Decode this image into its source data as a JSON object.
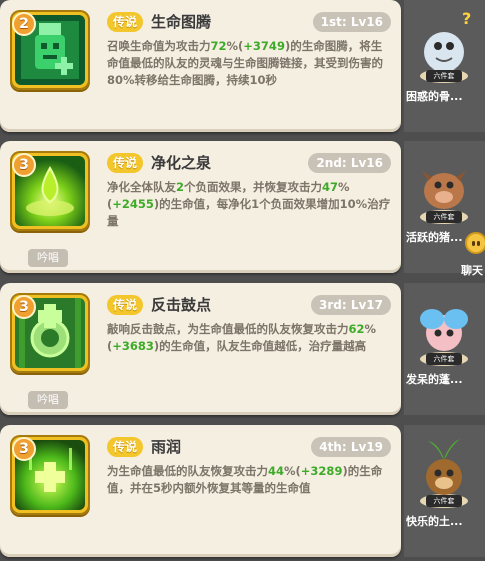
{
  "skills": [
    {
      "level_badge": "2",
      "rarity": "传说",
      "name": "生命图腾",
      "slot_level": "1st: Lv16",
      "desc": [
        {
          "t": "召唤生命值为攻击力"
        },
        {
          "t": "72",
          "g": true
        },
        {
          "t": "%("
        },
        {
          "t": "+3749",
          "g": true
        },
        {
          "t": ")的生命图腾，将生命值最低的队友的灵魂与生命图腾链接，其受到伤害的80%转移给生命图腾，持续10秒"
        }
      ],
      "chant": ""
    },
    {
      "level_badge": "3",
      "rarity": "传说",
      "name": "净化之泉",
      "slot_level": "2nd: Lv16",
      "desc": [
        {
          "t": "净化全体队友"
        },
        {
          "t": "2",
          "g": true
        },
        {
          "t": "个负面效果，并恢复攻击力"
        },
        {
          "t": "47",
          "g": true
        },
        {
          "t": "%("
        },
        {
          "t": "+2455",
          "g": true
        },
        {
          "t": ")的生命值，每净化1个负面效果增加10%治疗量"
        }
      ],
      "chant": "吟唱"
    },
    {
      "level_badge": "3",
      "rarity": "传说",
      "name": "反击鼓点",
      "slot_level": "3rd: Lv17",
      "desc": [
        {
          "t": "敲响反击鼓点，为生命值最低的队友恢复攻击力"
        },
        {
          "t": "62",
          "g": true
        },
        {
          "t": "%("
        },
        {
          "t": "+3683",
          "g": true
        },
        {
          "t": ")的生命值，队友生命值越低，治疗量越高"
        }
      ],
      "chant": "吟唱"
    },
    {
      "level_badge": "3",
      "rarity": "传说",
      "name": "雨润",
      "slot_level": "4th: Lv19",
      "desc": [
        {
          "t": "为生命值最低的队友恢复攻击力"
        },
        {
          "t": "44",
          "g": true
        },
        {
          "t": "%("
        },
        {
          "t": "+3289",
          "g": true
        },
        {
          "t": ")的生命值，并在5秒内额外恢复其等量的生命值"
        }
      ],
      "chant": ""
    }
  ],
  "pets": [
    {
      "tag": "六件套",
      "name": "困惑的骨..."
    },
    {
      "tag": "六件套",
      "name": "活跃的猪..."
    },
    {
      "tag": "六件套",
      "name": "发呆的蓬..."
    },
    {
      "tag": "六件套",
      "name": "快乐的土..."
    }
  ],
  "chat": {
    "label": "聊天"
  },
  "colors": {
    "highlight": "#3dab27",
    "rarity": "#f3c62b",
    "card": "#f5efe2"
  }
}
